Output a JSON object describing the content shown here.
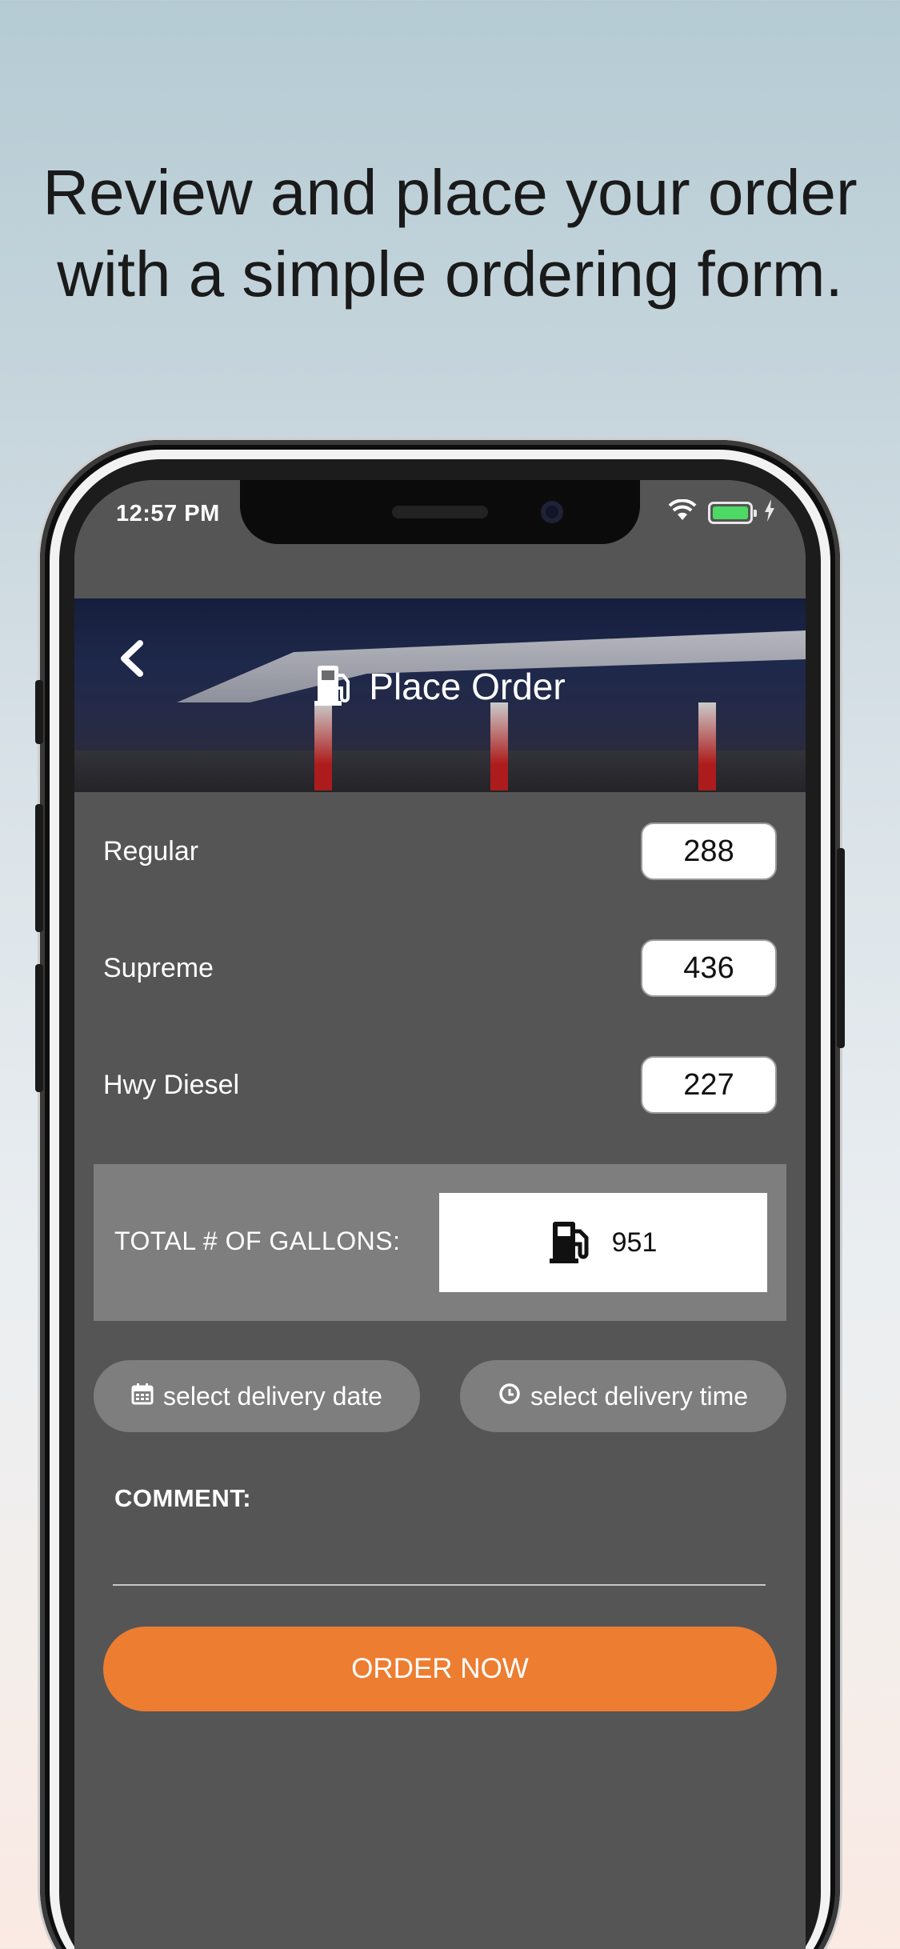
{
  "headline": {
    "line1": "Review and place your order",
    "line2": "with a simple ordering form."
  },
  "status_bar": {
    "time": "12:57 PM",
    "icons": [
      "wifi-icon",
      "battery-icon",
      "charging-bolt-icon"
    ],
    "battery_color": "#4cd964"
  },
  "header": {
    "title": "Place Order",
    "back_icon": "chevron-left-icon",
    "title_icon": "fuel-pump-icon"
  },
  "fuel_items": [
    {
      "label": "Regular",
      "quantity": "288"
    },
    {
      "label": "Supreme",
      "quantity": "436"
    },
    {
      "label": "Hwy Diesel",
      "quantity": "227"
    }
  ],
  "total": {
    "label": "TOTAL # OF GALLONS:",
    "value": "951",
    "icon": "fuel-pump-icon"
  },
  "delivery": {
    "date_label": "select delivery date",
    "date_icon": "calendar-icon",
    "time_label": "select delivery time",
    "time_icon": "clock-icon"
  },
  "comment": {
    "label": "COMMENT:",
    "value": ""
  },
  "order_button": {
    "label": "ORDER NOW",
    "color": "#ed7d31"
  },
  "colors": {
    "screen_bg": "#555555",
    "panel_bg": "#7e7e7e",
    "accent": "#ed7d31"
  }
}
